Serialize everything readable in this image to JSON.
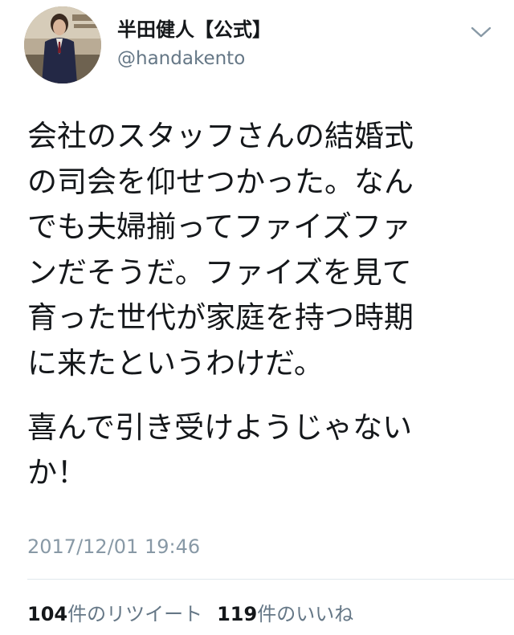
{
  "user": {
    "display_name": "半田健人【公式】",
    "handle": "@handakento"
  },
  "tweet": {
    "paragraphs": [
      "会社のスタッフさんの結婚式\nの司会を仰せつかった。なん\nでも夫婦揃ってファイズファ\nンだそうだ。ファイズを見て\n育った世代が家庭を持つ時期\nに来たというわけだ。",
      "喜んで引き受けようじゃない\nか！"
    ],
    "timestamp": "2017/12/01 19:46"
  },
  "stats": {
    "retweets": {
      "count": "104",
      "label": "件のリツイート"
    },
    "likes": {
      "count": "119",
      "label": "件のいいね"
    }
  },
  "icons": {
    "caret": "chevron-down-icon",
    "avatar": "avatar"
  },
  "colors": {
    "primary_text": "#14171a",
    "secondary_text": "#657786",
    "timestamp_text": "#8899a6",
    "divider": "#e1e8ed"
  }
}
